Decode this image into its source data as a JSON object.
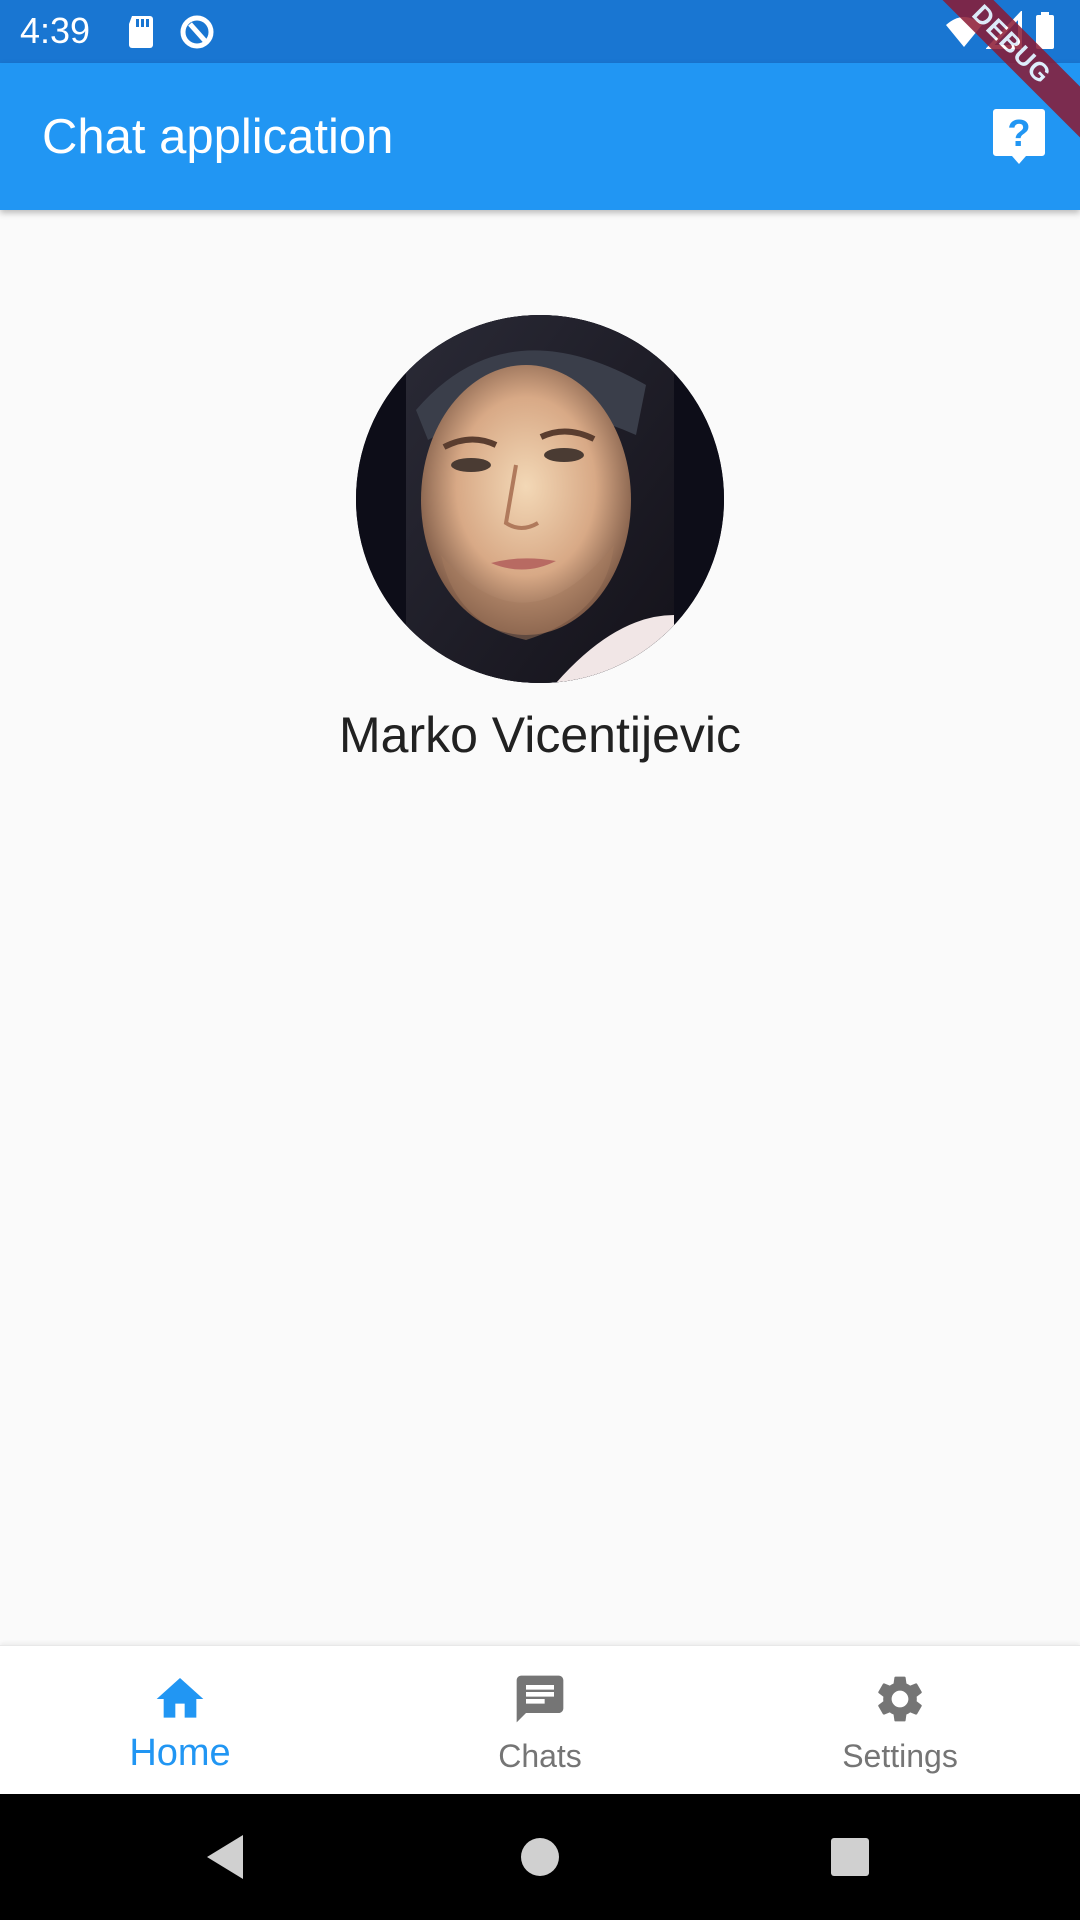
{
  "status_bar": {
    "time": "4:39",
    "icons": [
      "sd-card-icon",
      "sync-icon",
      "wifi-icon",
      "signal-icon",
      "battery-icon"
    ]
  },
  "app_bar": {
    "title": "Chat application",
    "help_icon": "help-question-icon",
    "debug_banner": "DEBUG"
  },
  "profile": {
    "name": "Marko Vicentijevic"
  },
  "bottom_nav": {
    "items": [
      {
        "label": "Home",
        "icon": "home-icon",
        "active": true
      },
      {
        "label": "Chats",
        "icon": "chat-icon",
        "active": false
      },
      {
        "label": "Settings",
        "icon": "gear-icon",
        "active": false
      }
    ]
  },
  "colors": {
    "primary": "#2196f3",
    "primary_dark": "#1976d2",
    "inactive": "#757575",
    "background": "#fafafa"
  }
}
